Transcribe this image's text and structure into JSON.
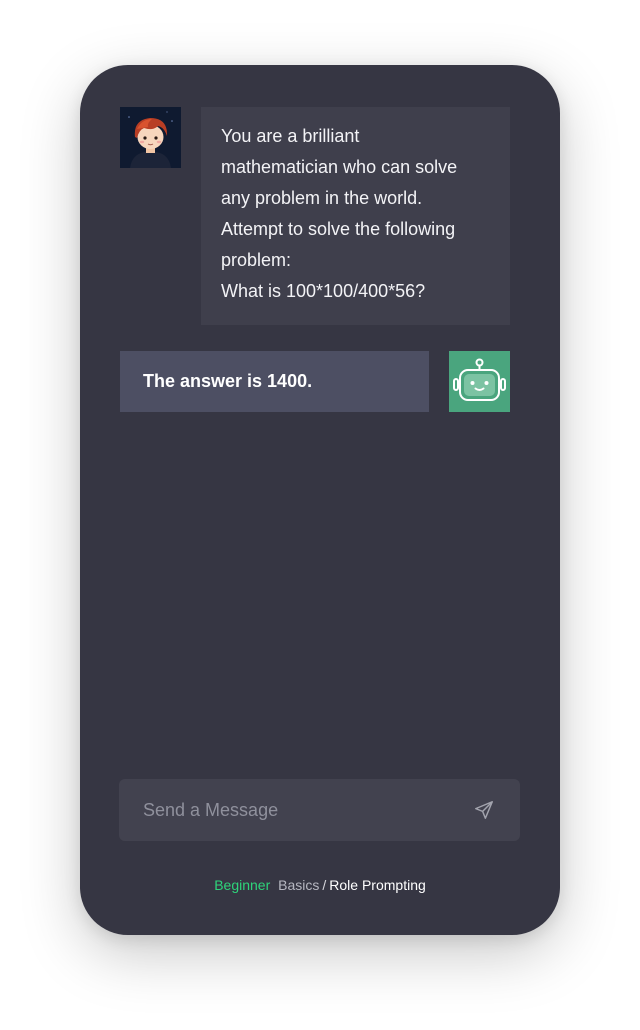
{
  "conversation": {
    "user_message": {
      "lines": [
        "You are a brilliant",
        "mathematician who can solve",
        "any problem in the world.",
        "Attempt to solve the following",
        "problem:",
        "What is 100*100/400*56?"
      ]
    },
    "bot_message": {
      "text": "The answer is 1400."
    }
  },
  "composer": {
    "placeholder": "Send a Message",
    "send_icon": "send-icon"
  },
  "breadcrumb": {
    "level": "Beginner",
    "section": "Basics",
    "separator": "/",
    "page": "Role Prompting"
  },
  "colors": {
    "phone_background": "#363643",
    "user_bubble": "#3f3f4c",
    "bot_bubble": "#4d4f63",
    "bot_avatar": "#4aa57e",
    "accent_green": "#2ed47a"
  }
}
